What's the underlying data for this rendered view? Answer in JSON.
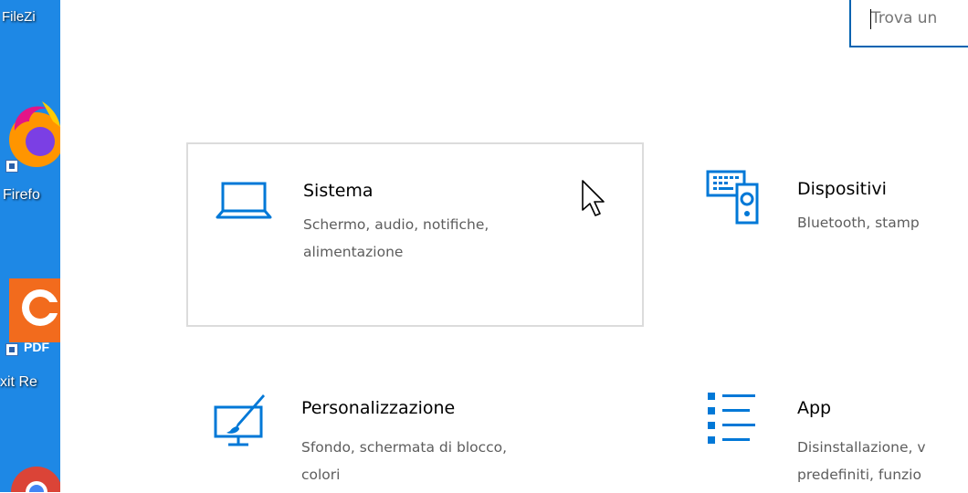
{
  "desktop": {
    "items": [
      {
        "label": "FileZi",
        "icon": "filezilla-icon"
      },
      {
        "label": "Firefo",
        "icon": "firefox-icon"
      },
      {
        "label": "xit Re",
        "icon": "foxit-reader-icon",
        "badge": "PDF"
      },
      {
        "label": "",
        "icon": "chrome-icon"
      }
    ]
  },
  "search": {
    "placeholder": "Trova un"
  },
  "tiles": [
    {
      "title": "Sistema",
      "desc_line1": "Schermo, audio, notifiche,",
      "desc_line2": "alimentazione",
      "icon": "laptop-icon"
    },
    {
      "title": "Dispositivi",
      "desc_line1": "Bluetooth, stamp",
      "desc_line2": "",
      "icon": "devices-icon"
    },
    {
      "title": "Personalizzazione",
      "desc_line1": "Sfondo, schermata di blocco,",
      "desc_line2": "colori",
      "icon": "personalization-icon"
    },
    {
      "title": "App",
      "desc_line1": "Disinstallazione, v",
      "desc_line2": "predefiniti, funzio",
      "icon": "apps-icon"
    }
  ],
  "colors": {
    "accent": "#0078d7",
    "desktop_bg": "#1e88e5"
  },
  "cursor": {
    "icon": "mouse-pointer-icon"
  }
}
